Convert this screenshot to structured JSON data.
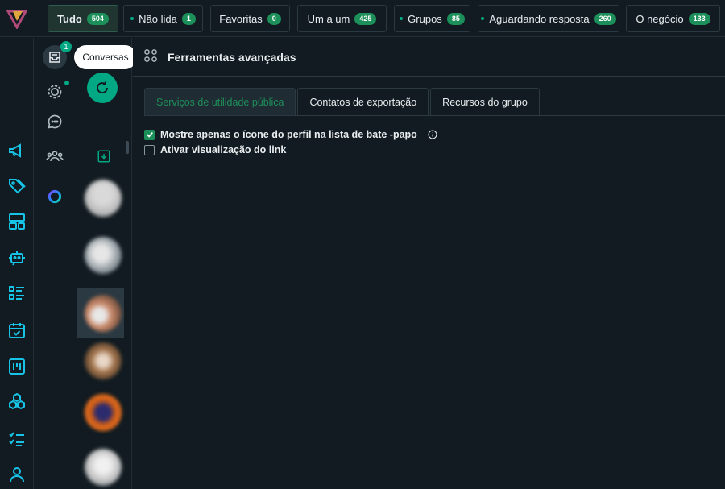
{
  "filters": [
    {
      "label": "Tudo",
      "count": "504",
      "active": true
    },
    {
      "label": "Não lida",
      "count": "1"
    },
    {
      "label": "Favoritas",
      "count": "0"
    },
    {
      "label": "Um a um",
      "count": "425"
    },
    {
      "label": "Grupos",
      "count": "85"
    },
    {
      "label": "Aguardando resposta",
      "count": "260"
    },
    {
      "label": "O negócio",
      "count": "133"
    }
  ],
  "col2": {
    "notif_count": "1"
  },
  "tooltip": "Conversas",
  "main": {
    "title": "Ferramentas avançadas",
    "tabs": [
      "Serviços de utilidade pública",
      "Contatos de exportação",
      "Recursos do grupo"
    ],
    "options": [
      {
        "label": "Mostre apenas o ícone do perfil na lista de bate -papo",
        "checked": true
      },
      {
        "label": "Ativar visualização do link",
        "checked": false
      }
    ]
  },
  "colors": {
    "accent": "#00a884",
    "badge": "#1d8f5a",
    "bg": "#111b21",
    "rail_icon": "#17c3e6"
  }
}
